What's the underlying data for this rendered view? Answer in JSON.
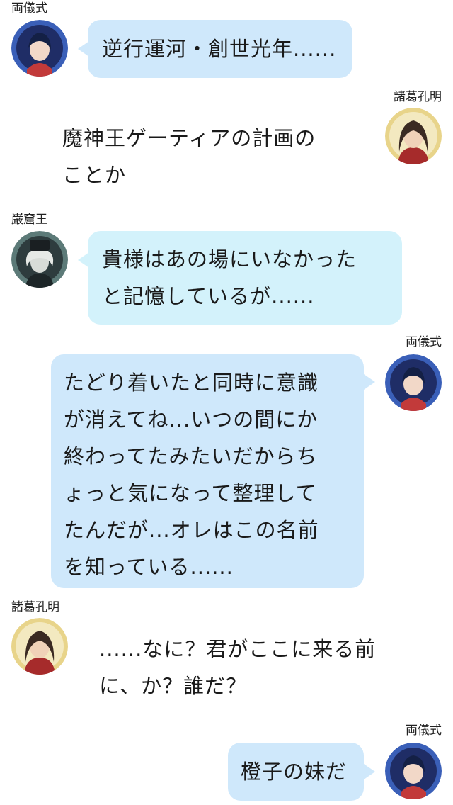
{
  "messages": [
    {
      "speaker": "両儀式",
      "side": "left",
      "text": "逆行運河・創世光年......"
    },
    {
      "speaker": "諸葛孔明",
      "side": "right",
      "text": "魔神王ゲーティアの計画の\nことか"
    },
    {
      "speaker": "巌窟王",
      "side": "left",
      "text": "貴様はあの場にいなかった\nと記憶しているが......"
    },
    {
      "speaker": "両儀式",
      "side": "right",
      "text": "たどり着いたと同時に意識\nが消えてね...いつの間にか\n終わってたみたいだからち\nょっと気になって整理して\nたんだが...オレはこの名前\nを知っている......"
    },
    {
      "speaker": "諸葛孔明",
      "side": "left",
      "text": "......なに？君がここに来る前\nに、か？誰だ？"
    },
    {
      "speaker": "両儀式",
      "side": "right",
      "text": "橙子の妹だ"
    }
  ],
  "colors": {
    "bubble_blue": "#cfe8fb",
    "bubble_cyan": "#d3f2fb",
    "background": "#ffffff"
  }
}
